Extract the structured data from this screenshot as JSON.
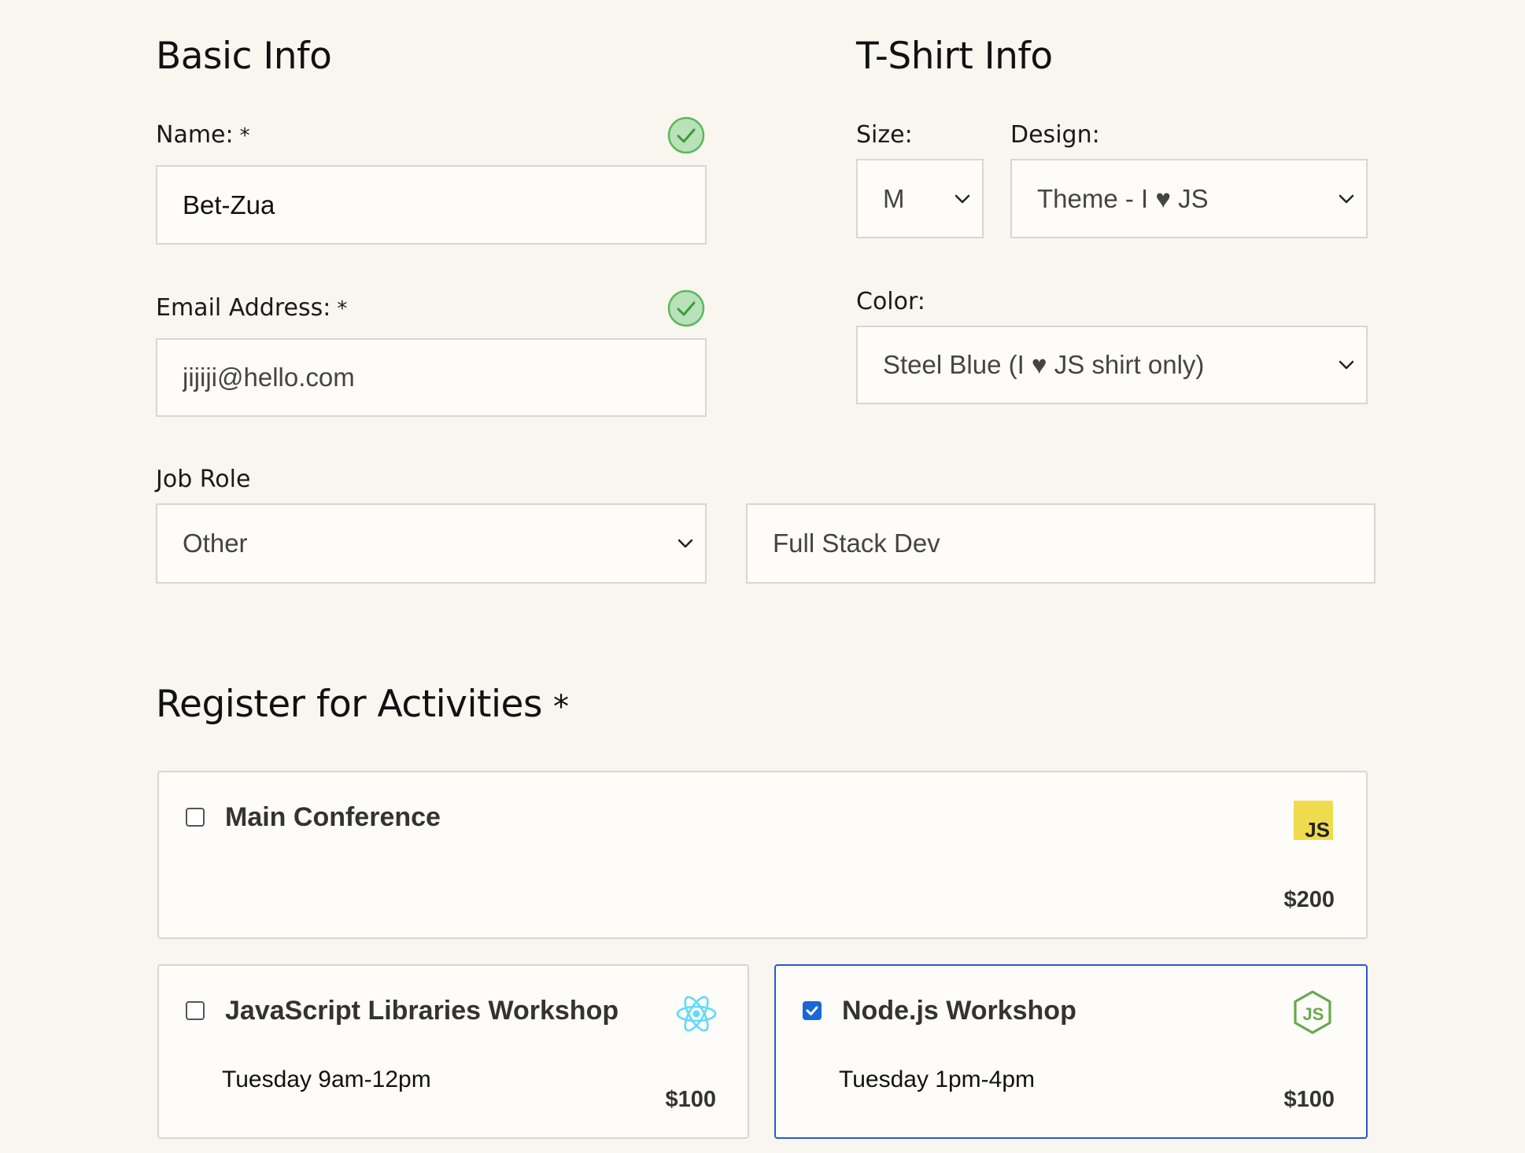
{
  "basic_info": {
    "title": "Basic Info",
    "name": {
      "label": "Name:",
      "required_mark": "*",
      "value": "Bet-Zua",
      "valid": true
    },
    "email": {
      "label": "Email Address:",
      "required_mark": "*",
      "value": "jijiji@hello.com",
      "valid": true
    },
    "job_role": {
      "label": "Job Role",
      "selected": "Other",
      "other_value": "Full Stack Dev"
    }
  },
  "tshirt_info": {
    "title": "T-Shirt Info",
    "size": {
      "label": "Size:",
      "selected": "M"
    },
    "design": {
      "label": "Design:",
      "selected": "Theme - I ♥ JS"
    },
    "color": {
      "label": "Color:",
      "selected": "Steel Blue (I ♥ JS shirt only)"
    }
  },
  "activities": {
    "title": "Register for Activities",
    "required_mark": "*",
    "items": [
      {
        "name": "Main Conference",
        "time": "",
        "price": "$200",
        "checked": false,
        "icon": "js-icon"
      },
      {
        "name": "JavaScript Libraries Workshop",
        "time": "Tuesday 9am-12pm",
        "price": "$100",
        "checked": false,
        "icon": "react-icon"
      },
      {
        "name": "Node.js Workshop",
        "time": "Tuesday 1pm-4pm",
        "price": "$100",
        "checked": true,
        "icon": "nodejs-icon"
      }
    ]
  },
  "colors": {
    "background": "#f9f6f0",
    "field_border": "#d7d6d2",
    "valid_green": "#5cb85c",
    "checked_blue": "#2b58c9",
    "js_yellow": "#f0db4f",
    "react_cyan": "#61dafb",
    "node_green": "#6aa84f"
  }
}
